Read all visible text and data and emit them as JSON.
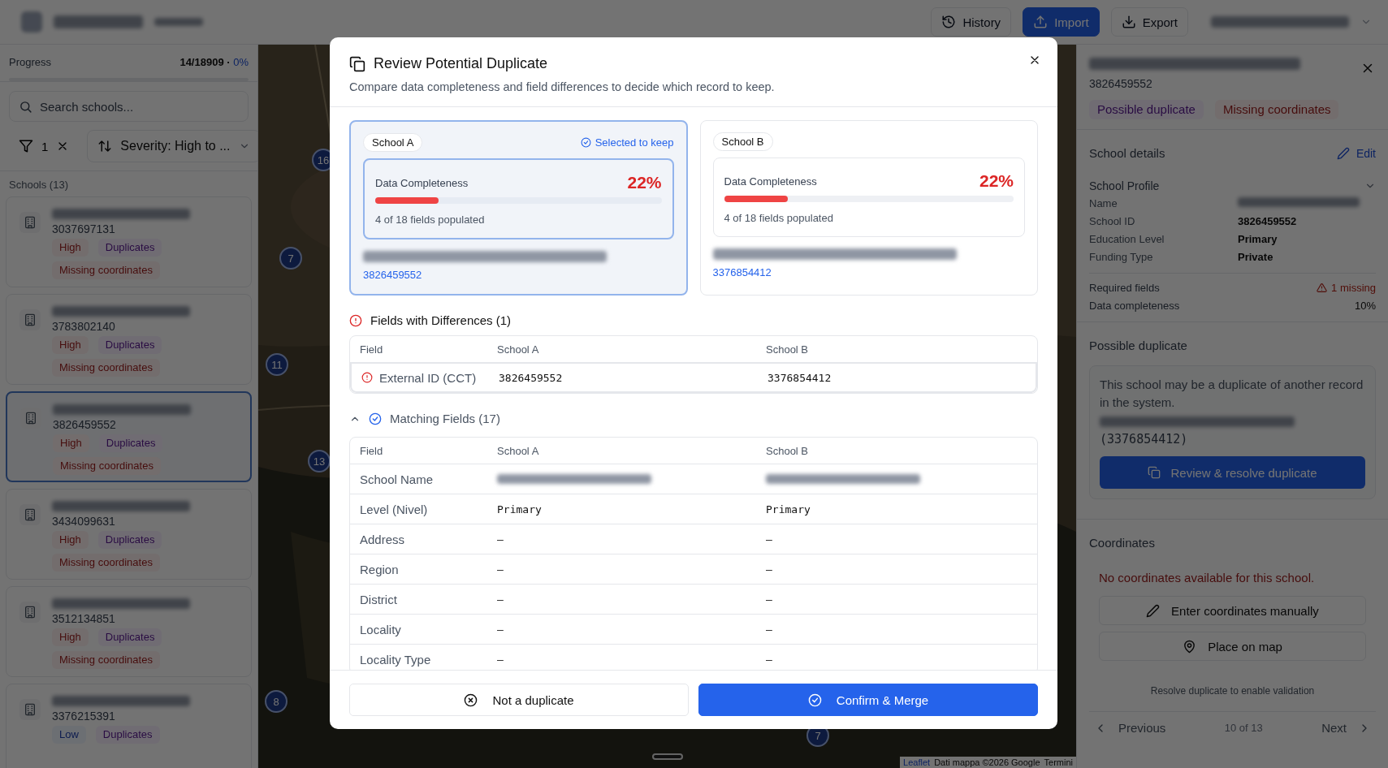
{
  "header": {
    "buttons": [
      {
        "label": "History",
        "kind": "history"
      },
      {
        "label": "Import",
        "kind": "import"
      },
      {
        "label": "Export",
        "kind": "export"
      }
    ]
  },
  "sidebar": {
    "progress_label": "Progress",
    "progress_count": "14/18909 ·",
    "progress_percent": "0%",
    "progress": {
      "level": 0
    },
    "search": {
      "placeholder": "Search schools..."
    },
    "filter_count": "1",
    "sort": "Severity: High to ...",
    "list_title": "Schools (13)",
    "schools": [
      {
        "id": "3037697131",
        "selected": false,
        "tags": [
          {
            "label": "High",
            "kind": "high"
          },
          {
            "label": "Duplicates",
            "kind": "duplicates"
          },
          {
            "label": "Missing coordinates",
            "kind": "missing"
          }
        ]
      },
      {
        "id": "3783802140",
        "selected": false,
        "tags": [
          {
            "label": "High",
            "kind": "high"
          },
          {
            "label": "Duplicates",
            "kind": "duplicates"
          },
          {
            "label": "Missing coordinates",
            "kind": "missing"
          }
        ]
      },
      {
        "id": "3826459552",
        "selected": true,
        "tags": [
          {
            "label": "High",
            "kind": "high"
          },
          {
            "label": "Duplicates",
            "kind": "duplicates"
          },
          {
            "label": "Missing coordinates",
            "kind": "missing"
          }
        ]
      },
      {
        "id": "3434099631",
        "selected": false,
        "tags": [
          {
            "label": "High",
            "kind": "high"
          },
          {
            "label": "Duplicates",
            "kind": "duplicates"
          },
          {
            "label": "Missing coordinates",
            "kind": "missing"
          }
        ]
      },
      {
        "id": "3512134851",
        "selected": false,
        "tags": [
          {
            "label": "High",
            "kind": "high"
          },
          {
            "label": "Duplicates",
            "kind": "duplicates"
          },
          {
            "label": "Missing coordinates",
            "kind": "missing"
          }
        ]
      },
      {
        "id": "3376215391",
        "selected": false,
        "tags": [
          {
            "label": "Low",
            "kind": "low"
          },
          {
            "label": "Duplicates",
            "kind": "duplicates"
          }
        ]
      }
    ]
  },
  "map": {
    "markers": [
      {
        "label": "16"
      },
      {
        "label": "7"
      },
      {
        "label": "11"
      },
      {
        "label": "13"
      },
      {
        "label": "8"
      },
      {
        "label": "7"
      }
    ],
    "attribution": [
      "Leaflet",
      "Dati mappa ©2026 Google",
      "Termini"
    ]
  },
  "detail": {
    "id": "3826459552",
    "tags": [
      {
        "label": "Possible duplicate",
        "kind": "duplicates"
      },
      {
        "label": "Missing coordinates",
        "kind": "missing"
      }
    ],
    "details_title": "School details",
    "edit": "Edit",
    "profile_title": "School Profile",
    "profile_expanded": true,
    "profile_rows": [
      {
        "label": "Name",
        "kind": "redacted"
      },
      {
        "label": "School ID",
        "value": "3826459552",
        "kind": "text"
      },
      {
        "label": "Education Level",
        "value": "Primary",
        "kind": "text"
      },
      {
        "label": "Funding Type",
        "value": "Private",
        "kind": "text"
      }
    ],
    "required_label": "Required fields",
    "required_value": "1 missing",
    "completeness_label": "Data completeness",
    "completeness_value": "10%",
    "duplicate_title": "Possible duplicate",
    "duplicate_message": "This school may be a duplicate of another record in the system.",
    "duplicate_id": "(3376854412)",
    "review_button": "Review & resolve duplicate",
    "coordinates_title": "Coordinates",
    "coordinates_message": "No coordinates available for this school.",
    "coordinate_buttons": [
      {
        "label": "Enter coordinates manually",
        "kind": "edit"
      },
      {
        "label": "Place on map",
        "kind": "pin"
      }
    ],
    "validation_note": "Resolve duplicate to enable validation",
    "previous": "Previous",
    "position": "10 of 13",
    "next": "Next"
  },
  "modal": {
    "title": "Review Potential Duplicate",
    "subtitle": "Compare data completeness and field differences to decide which record to keep.",
    "selected_label": "Selected to keep",
    "records": [
      {
        "label": "School A",
        "selected": true,
        "completeness_label": "Data Completeness",
        "percent": "22%",
        "level": 0.22,
        "fields": "4 of 18 fields populated",
        "id": "3826459552"
      },
      {
        "label": "School B",
        "selected": false,
        "completeness_label": "Data Completeness",
        "percent": "22%",
        "level": 0.22,
        "fields": "4 of 18 fields populated",
        "id": "3376854412"
      }
    ],
    "differences": {
      "title": "Fields with Differences (1)",
      "columns": [
        "Field",
        "School A",
        "School B"
      ],
      "rows": [
        {
          "field": "External ID (CCT)",
          "a": "3826459552",
          "b": "3376854412",
          "kind": "text"
        }
      ]
    },
    "matching": {
      "title": "Matching Fields (17)",
      "expanded": true,
      "columns": [
        "Field",
        "School A",
        "School B"
      ],
      "rows": [
        {
          "field": "School Name",
          "kind": "redacted"
        },
        {
          "field": "Level (Nivel)",
          "a": "Primary",
          "b": "Primary",
          "kind": "text"
        },
        {
          "field": "Address",
          "a": "–",
          "b": "–",
          "kind": "text"
        },
        {
          "field": "Region",
          "a": "–",
          "b": "–",
          "kind": "text"
        },
        {
          "field": "District",
          "a": "–",
          "b": "–",
          "kind": "text"
        },
        {
          "field": "Locality",
          "a": "–",
          "b": "–",
          "kind": "text"
        },
        {
          "field": "Locality Type",
          "a": "–",
          "b": "–",
          "kind": "text"
        }
      ]
    },
    "buttons": [
      {
        "label": "Not a duplicate",
        "kind": "secondary"
      },
      {
        "label": "Confirm & Merge",
        "kind": "primary"
      }
    ]
  }
}
